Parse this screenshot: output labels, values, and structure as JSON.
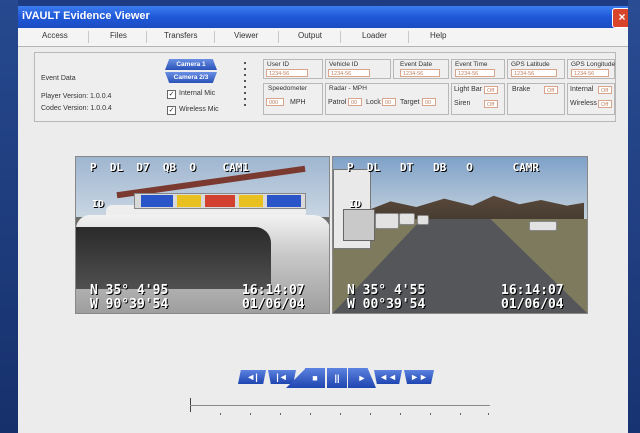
{
  "window": {
    "title": "iVAULT Evidence Viewer",
    "close": "×"
  },
  "tabs": [
    "Access",
    "Files",
    "Transfers",
    "Viewer",
    "Output",
    "Loader",
    "Help"
  ],
  "event_panel": {
    "event_data_label": "Event Data",
    "player_version": "Player Version: 1.0.0.4",
    "codec_version": "Codec Version: 1.0.0.4",
    "camera1": "Camera 1",
    "camera23": "Camera 2/3",
    "internal_mic": "Internal Mic",
    "wireless_mic": "Wireless Mic"
  },
  "fields": {
    "user_id": {
      "label": "User ID",
      "value": "1234-56"
    },
    "vehicle_id": {
      "label": "Vehicle ID",
      "value": "1234-56"
    },
    "event_date": {
      "label": "Event Date",
      "value": "1234-56"
    },
    "event_time": {
      "label": "Event Time",
      "value": "1234-56"
    },
    "gps_lat": {
      "label": "GPS Latitude",
      "value": "1234-56"
    },
    "gps_long": {
      "label": "GPS Longitude",
      "value": "1234-56"
    },
    "speedometer": {
      "label": "Speedometer",
      "value": "000",
      "unit": "MPH"
    },
    "radar": {
      "label": "Radar - MPH",
      "patrol": "Patrol",
      "lock": "Lock",
      "target": "Target",
      "patrol_val": "00",
      "lock_val": "00",
      "target_val": "00"
    },
    "light_bar": {
      "label": "Light Bar",
      "value": "Off"
    },
    "siren": {
      "label": "Siren",
      "value": "Off"
    },
    "brake": {
      "label": "Brake",
      "value": "Off"
    },
    "internal": {
      "label": "Internal",
      "value": "Off"
    },
    "wireless": {
      "label": "Wireless",
      "value": "Off"
    }
  },
  "video_left": {
    "top_osd": "P  DL  D7  QB  O    CAM1",
    "top_osd2": "ID",
    "lat": "N 35° 4'95",
    "lon": "W 90°39'54",
    "time": "16:14:07",
    "date": "01/06/04"
  },
  "video_right": {
    "top_osd": "P  DL   DT   DB   O      CAMR",
    "top_osd2": "ID",
    "lat": "N 35° 4'55",
    "lon": "W 00°39'54",
    "time": "16:14:07",
    "date": "01/06/04"
  },
  "controls": {
    "prev_chapter": "◄|",
    "step_back": "|◄",
    "stop": "■",
    "pause": "||",
    "play": "►",
    "rewind": "◄◄",
    "fast_forward": "►►"
  }
}
